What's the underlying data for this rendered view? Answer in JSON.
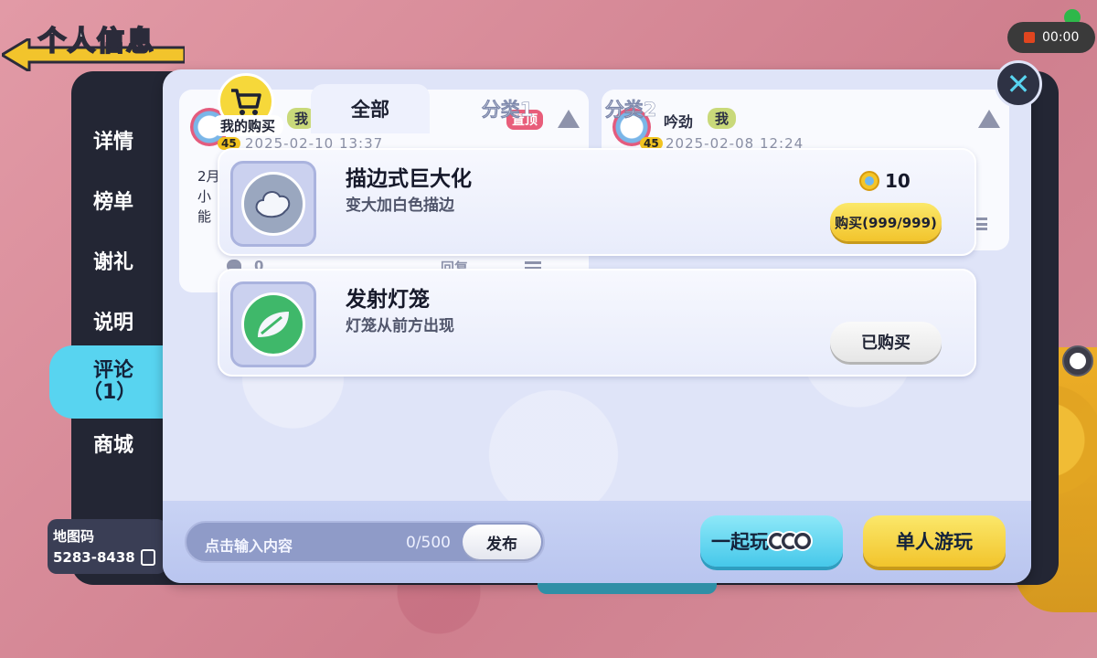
{
  "page": {
    "title": "个人信息"
  },
  "system": {
    "record_time": "00:00"
  },
  "sidebar": {
    "items": [
      {
        "label": "详情"
      },
      {
        "label": "榜单"
      },
      {
        "label": "谢礼"
      },
      {
        "label": "说明"
      },
      {
        "label": "评论",
        "sub": "（1）",
        "active": true
      },
      {
        "label": "商城"
      }
    ],
    "map_code_label": "地图码",
    "map_code_value": "5283-8438"
  },
  "purchase_badge": {
    "label": "我的购买"
  },
  "tabs": [
    {
      "label": "全部",
      "active": true
    },
    {
      "label": "分类1"
    },
    {
      "label": "分类2"
    }
  ],
  "background_comments": [
    {
      "level": "45",
      "me_tag": "我",
      "pin_tag": "置顶",
      "date": "2025-02-10 13:37",
      "text_lines": [
        "2月",
        "小",
        "能"
      ],
      "likes": "0",
      "reply_label": "回复"
    },
    {
      "level": "45",
      "name": "吟劲",
      "me_tag": "我",
      "date": "2025-02-08 12:24"
    }
  ],
  "shop_items": [
    {
      "title": "描边式巨大化",
      "desc": "变大加白色描边",
      "price": "10",
      "button": "购买(999/999)",
      "icon": "cloud-icon",
      "purchased": false
    },
    {
      "title": "发射灯笼",
      "desc": "灯笼从前方出现",
      "button": "已购买",
      "icon": "leaf-icon",
      "purchased": true
    }
  ],
  "comment_input": {
    "placeholder": "点击输入内容",
    "count": "0/500",
    "publish_label": "发布"
  },
  "actions": {
    "play_together": "一起玩",
    "solo_play": "单人游玩"
  },
  "colors": {
    "accent_cyan": "#58d4f0",
    "accent_yellow": "#f2c42c",
    "panel_dark": "#232634",
    "modal_bg": "#dfe4f8"
  }
}
